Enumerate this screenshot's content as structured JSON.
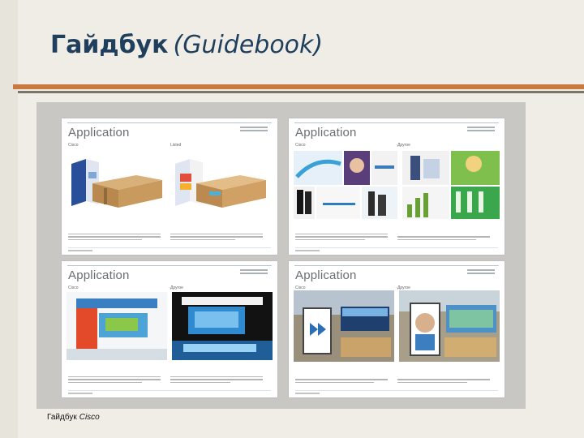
{
  "slide": {
    "title_ru": "Гайдбук",
    "title_en": "(Guidebook)",
    "footer_label": "Гайдбук",
    "footer_brand": "Cisco"
  },
  "pages": [
    {
      "heading": "Application",
      "left_caption": "Cisco",
      "right_caption": "Listed"
    },
    {
      "heading": "Application",
      "left_caption": "Cisco",
      "right_caption": "Другое"
    },
    {
      "heading": "Application",
      "left_caption": "Cisco",
      "right_caption": "Другое"
    },
    {
      "heading": "Application",
      "left_caption": "Cisco",
      "right_caption": "Другое"
    }
  ]
}
